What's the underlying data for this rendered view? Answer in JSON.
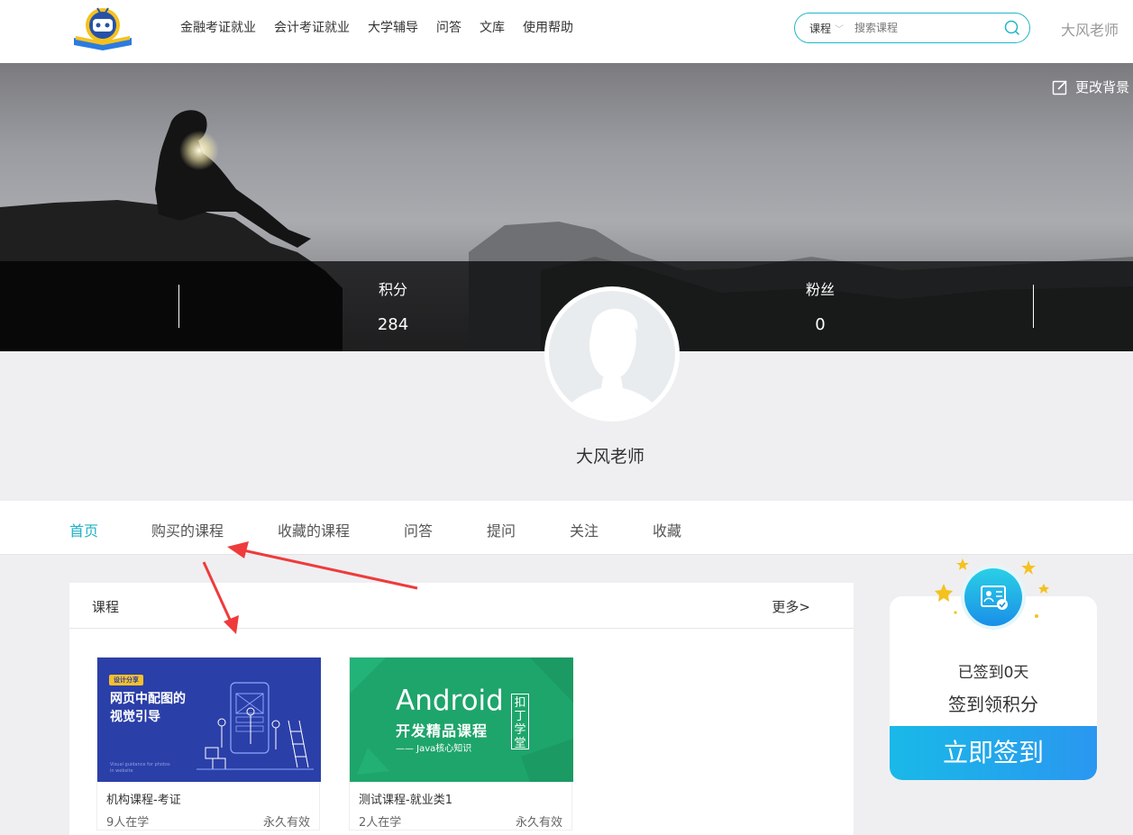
{
  "header": {
    "nav": [
      "金融考证就业",
      "会计考证就业",
      "大学辅导",
      "问答",
      "文库",
      "使用帮助"
    ],
    "search": {
      "type": "课程",
      "placeholder": "搜索课程"
    },
    "user_name": "大风老师"
  },
  "banner": {
    "change_bg": "更改背景",
    "stats": [
      {
        "label": "积分",
        "value": "284"
      },
      {
        "label": "粉丝",
        "value": "0"
      }
    ]
  },
  "profile": {
    "name": "大风老师"
  },
  "tabs": [
    {
      "label": "首页",
      "active": true
    },
    {
      "label": "购买的课程"
    },
    {
      "label": "收藏的课程"
    },
    {
      "label": "问答"
    },
    {
      "label": "提问"
    },
    {
      "label": "关注"
    },
    {
      "label": "收藏"
    }
  ],
  "courses_panel": {
    "title": "课程",
    "more": "更多>",
    "cards": [
      {
        "title": "机构课程-考证",
        "students": "9人在学",
        "validity": "永久有效",
        "cover": {
          "tag": "设计分享",
          "line1": "网页中配图的",
          "line2": "视觉引导",
          "small1": "Visual guidance for photos",
          "small2": "in website"
        }
      },
      {
        "title": "测试课程-就业类1",
        "students": "2人在学",
        "validity": "永久有效",
        "cover": {
          "line1": "Android",
          "line2": "开发精品课程",
          "line3": "—— Java核心知识",
          "stamp": "扣丁学堂"
        }
      }
    ]
  },
  "sign": {
    "days": "已签到0天",
    "subtitle": "签到领积分",
    "button": "立即签到"
  },
  "colors": {
    "accent": "#1eb2c6",
    "sign_button": "#2a97f0"
  }
}
